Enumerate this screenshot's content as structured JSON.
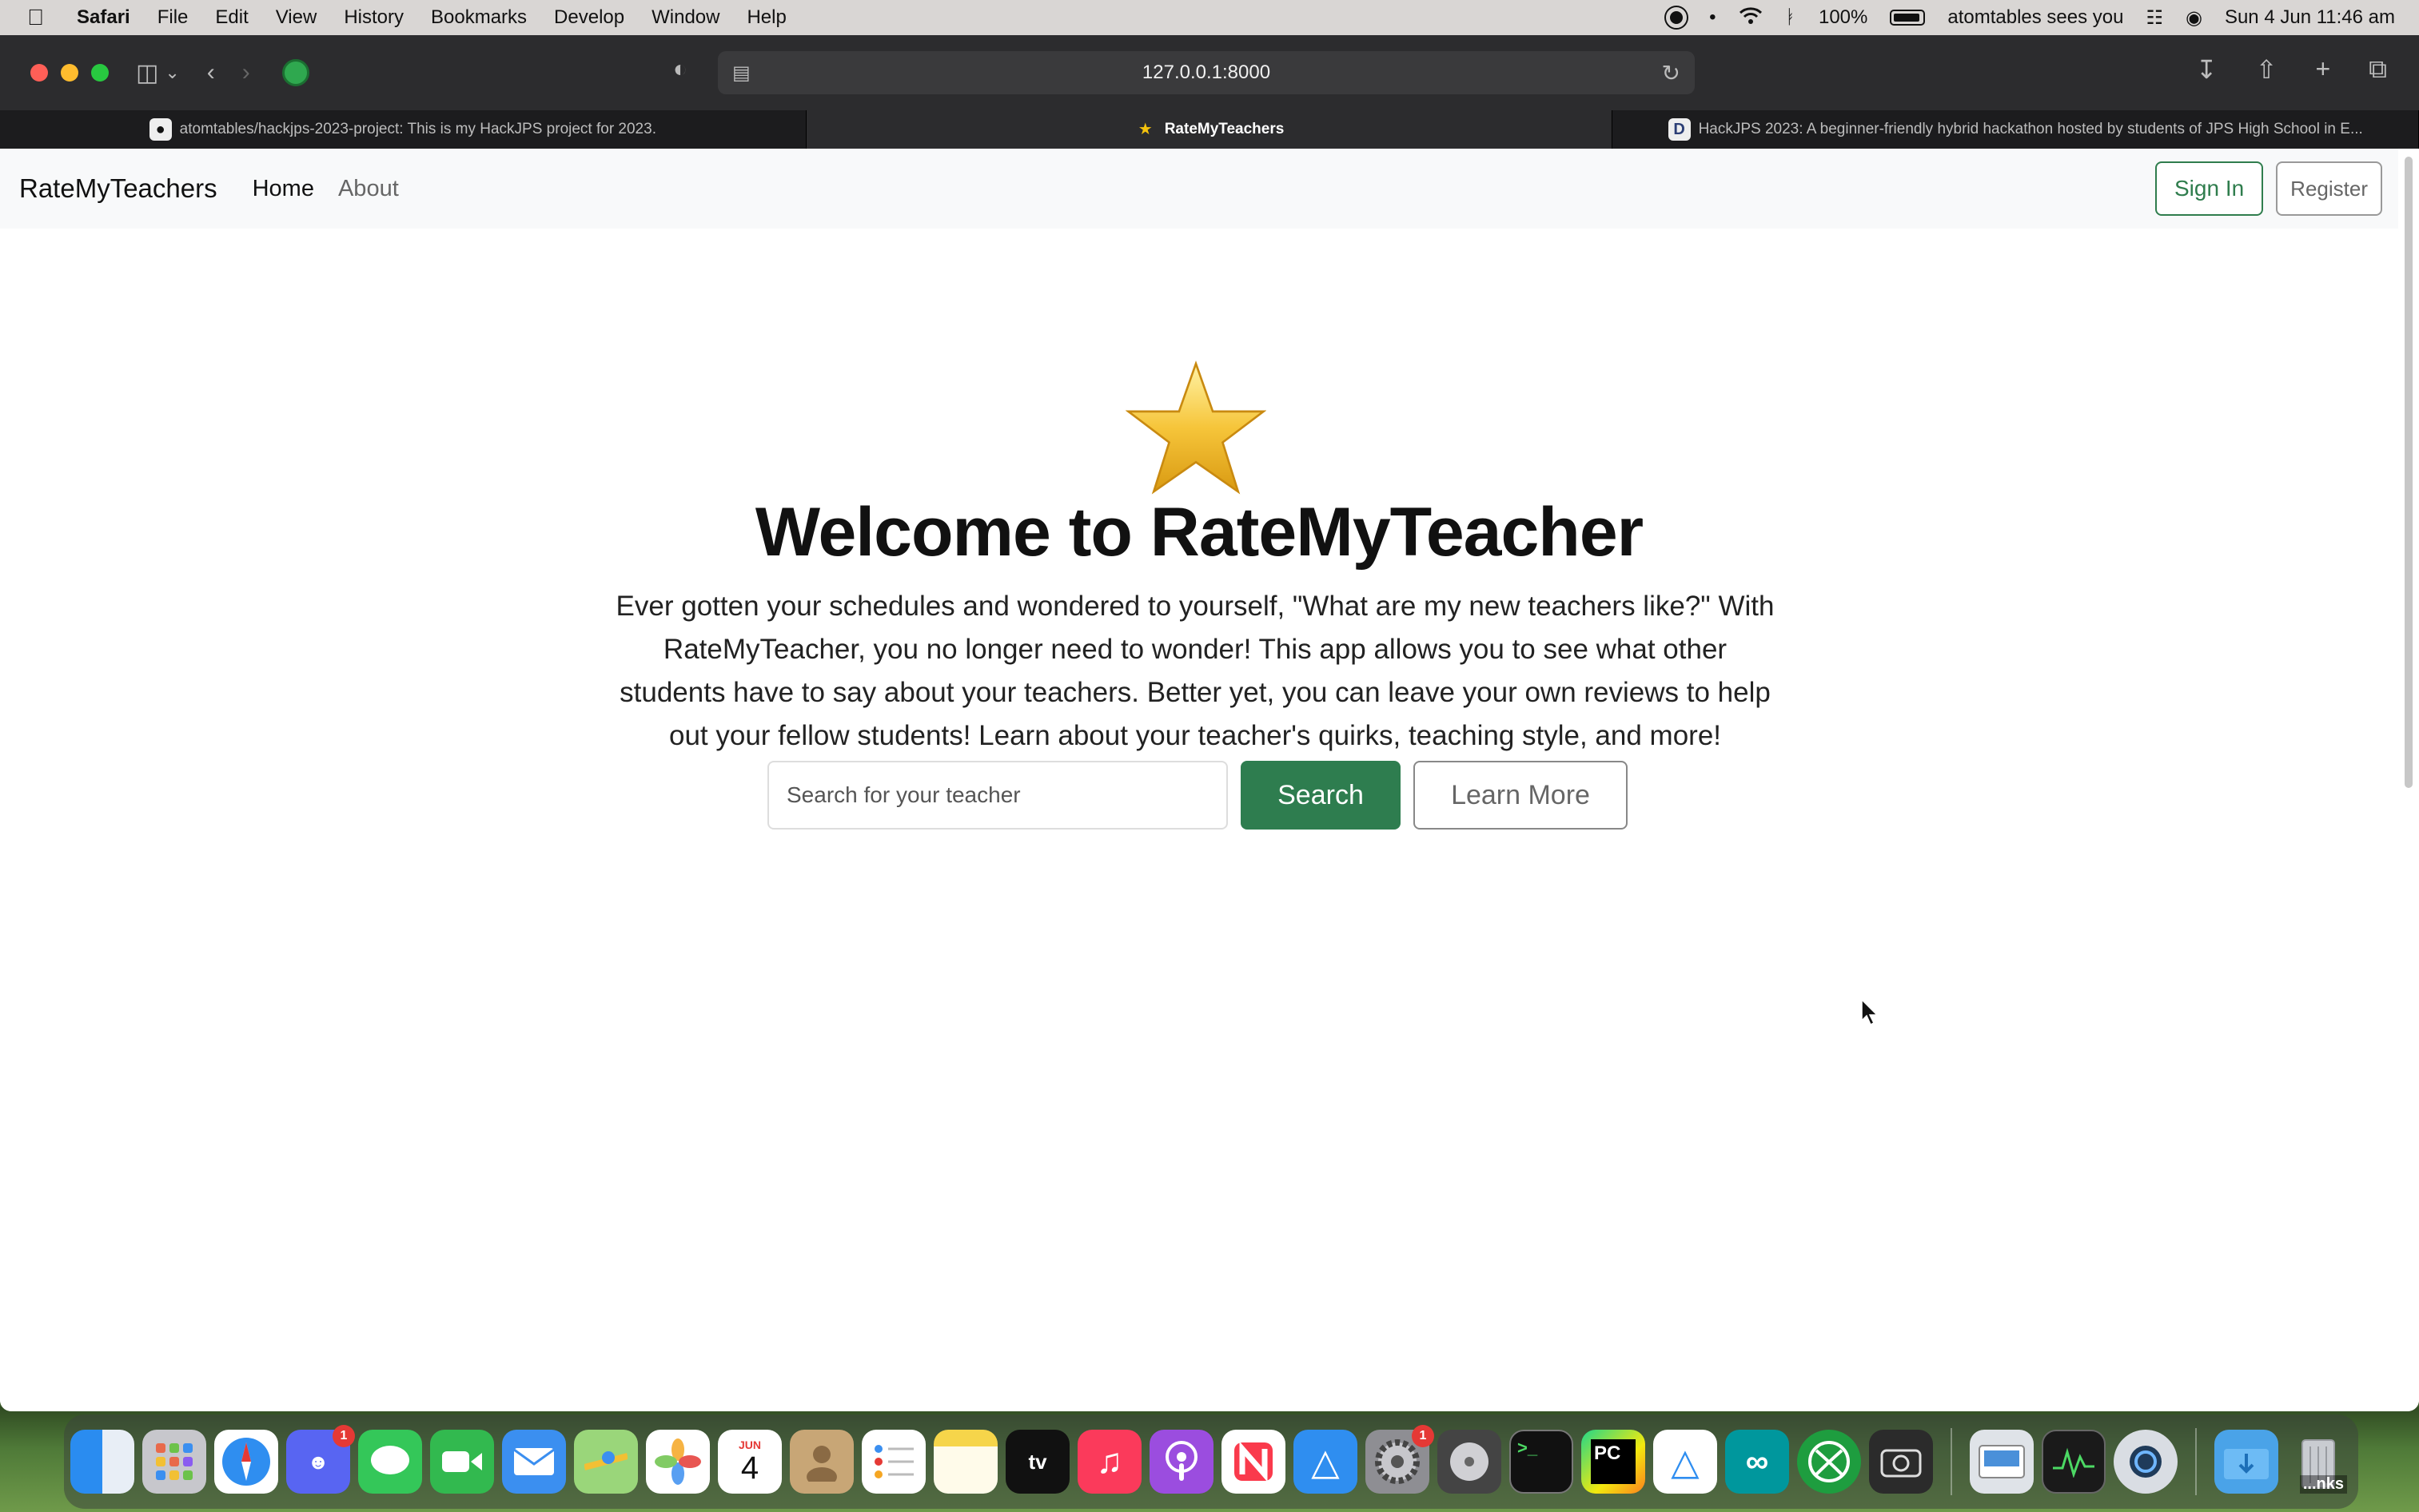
{
  "menubar": {
    "app_name": "Safari",
    "menus": [
      "File",
      "Edit",
      "View",
      "History",
      "Bookmarks",
      "Develop",
      "Window",
      "Help"
    ],
    "battery": "100%",
    "user_status": "atomtables sees you",
    "datetime": "Sun 4 Jun  11:46 am"
  },
  "browser": {
    "url": "127.0.0.1:8000",
    "tabs": [
      {
        "title": "atomtables/hackjps-2023-project: This is my HackJPS project for 2023.",
        "favicon": "github-icon"
      },
      {
        "title": "RateMyTeachers",
        "favicon": "star-icon"
      },
      {
        "title": "HackJPS 2023: A beginner-friendly hybrid hackathon hosted by students of JPS High School in E...",
        "favicon": "devpost-icon"
      }
    ]
  },
  "navbar": {
    "brand": "RateMyTeachers",
    "links": [
      "Home",
      "About"
    ],
    "sign_in": "Sign In",
    "register": "Register"
  },
  "hero": {
    "title": "Welcome to RateMyTeacher",
    "description": "Ever gotten your schedules and wondered to yourself, \"What are my new teachers like?\" With RateMyTeacher, you no longer need to wonder! This app allows you to see what other students have to say about your teachers. Better yet, you can leave your own reviews to help out your fellow students! Learn about your teacher's quirks, teaching style, and more!",
    "search_placeholder": "Search for your teacher",
    "search_button": "Search",
    "learn_more_button": "Learn More"
  },
  "dock": {
    "calendar_month": "JUN",
    "calendar_day": "4",
    "discord_badge": "1",
    "settings_badge": "1",
    "tv_label": "tv",
    "pycharm_label": "PC",
    "stacks_label": "...nks"
  },
  "colors": {
    "primary_green": "#2e7d4f",
    "navbar_bg": "#f8f9fa",
    "browser_chrome": "#2c2c2e"
  }
}
